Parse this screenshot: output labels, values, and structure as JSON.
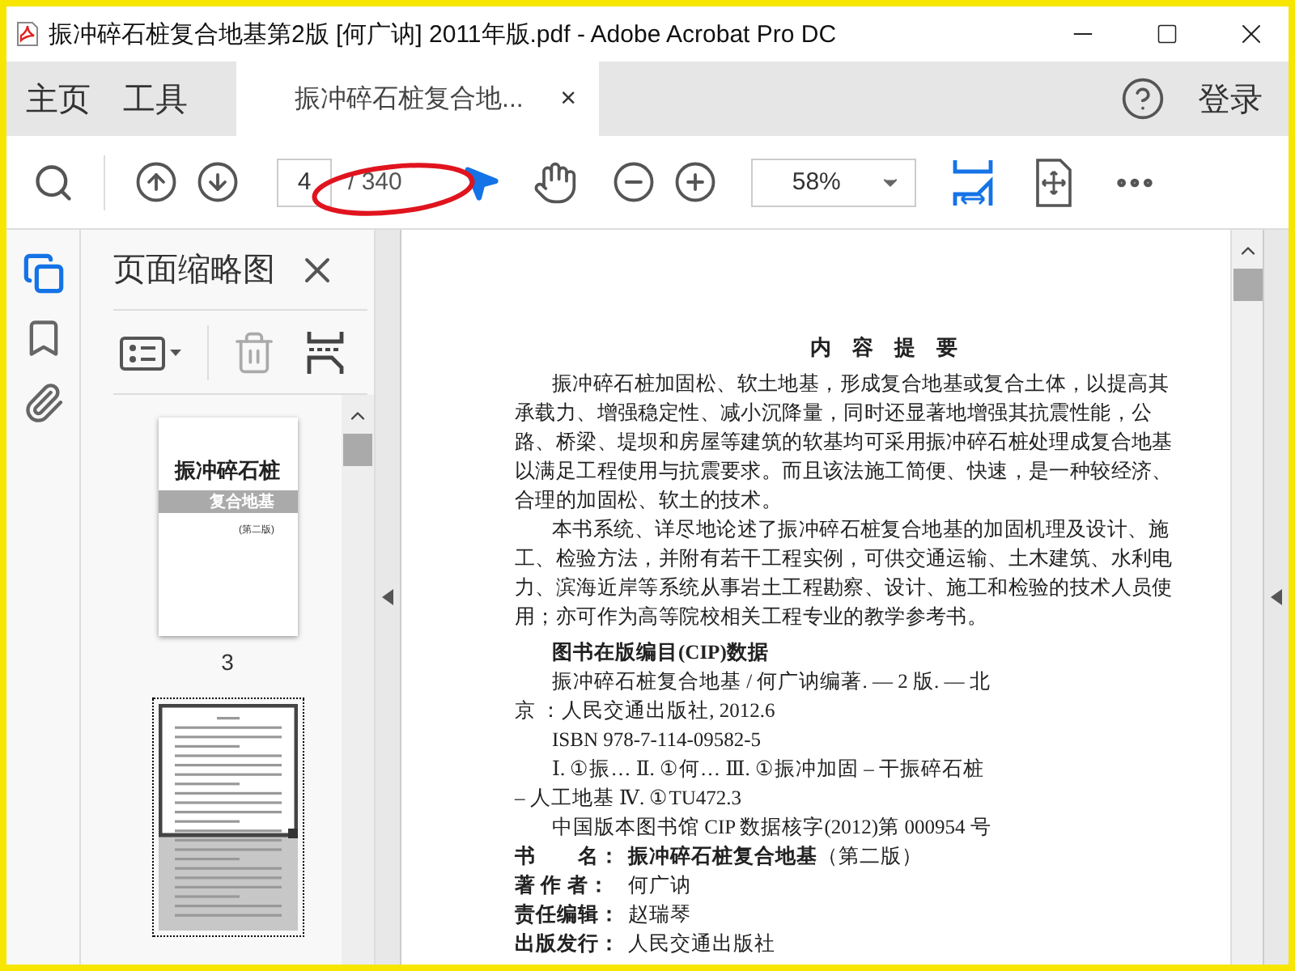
{
  "window": {
    "title": "振冲碎石桩复合地基第2版 [何广讷] 2011年版.pdf - Adobe Acrobat Pro DC"
  },
  "nav_tabs": [
    {
      "label": "主页",
      "selected": false
    },
    {
      "label": "工具",
      "selected": false
    }
  ],
  "document_tab": {
    "label": "振冲碎石桩复合地...",
    "selected": true,
    "close": "×"
  },
  "sign_in": "登录",
  "toolbar": {
    "page_number": "4",
    "page_total": "/ 340",
    "zoom": "58%"
  },
  "sidebar": {
    "tools": [
      {
        "kind": "pages",
        "selected": true
      },
      {
        "kind": "bookmarks",
        "selected": false
      },
      {
        "kind": "attachments",
        "selected": false
      }
    ]
  },
  "thumbnail_panel": {
    "title": "页面缩略图",
    "thumbnails": [
      {
        "kind": "cover",
        "selected": false,
        "cover_title": "振冲碎石桩",
        "cover_subtitle": "复合地基",
        "edition": "(第二版)",
        "label": "3"
      },
      {
        "kind": "text",
        "selected": true
      }
    ]
  },
  "page": {
    "lines": [
      {
        "kind": "heading",
        "text": "内　容　提　要"
      },
      {
        "kind": "para",
        "text": "振冲碎石桩加固松、软土地基，形成复合地基或复合土体，以提高其承载力、增强稳定性、减小沉降量，同时还显著地增强其抗震性能，公路、桥梁、堤坝和房屋等建筑的软基均可采用振冲碎石桩处理成复合地基以满足工程使用与抗震要求。而且该法施工简便、快速，是一种较经济、合理的加固松、软土的技术。"
      },
      {
        "kind": "para",
        "text": "本书系统、详尽地论述了振冲碎石桩复合地基的加固机理及设计、施工、检验方法，并附有若干工程实例，可供交通运输、土木建筑、水利电力、滨海近岸等系统从事岩土工程勘察、设计、施工和检验的技术人员使用；亦可作为高等院校相关工程专业的教学参考书。"
      },
      {
        "kind": "title",
        "text": "图书在版编目(CIP)数据"
      },
      {
        "kind": "indent",
        "text": "振冲碎石桩复合地基 / 何广讷编著. — 2 版. — 北"
      },
      {
        "kind": "flush",
        "text": "京 ：人民交通出版社, 2012.6"
      },
      {
        "kind": "indent",
        "text": "ISBN 978-7-114-09582-5"
      },
      {
        "kind": "indent",
        "text": "Ⅰ. ①振… Ⅱ. ①何… Ⅲ. ①振冲加固 – 干振碎石桩"
      },
      {
        "kind": "flush",
        "text": "– 人工地基 Ⅳ. ①TU472.3"
      },
      {
        "kind": "indent",
        "text": "中国版本图书馆 CIP 数据核字(2012)第 000954 号"
      },
      {
        "kind": "field",
        "label": "书　　名：",
        "value": "**振冲碎石桩复合地基**（第二版）"
      },
      {
        "kind": "field",
        "label": "著 作 者：",
        "value": "何广讷"
      },
      {
        "kind": "field",
        "label": "责任编辑：",
        "value": "赵瑞琴"
      },
      {
        "kind": "field",
        "label": "出版发行：",
        "value": "人民交通出版社"
      }
    ]
  }
}
